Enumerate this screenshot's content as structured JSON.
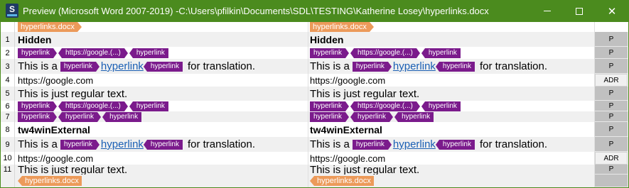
{
  "window": {
    "title": "Preview (Microsoft Word 2007-2019) -C:\\Users\\pfilkin\\Documents\\SDL\\TESTING\\Katherine Losey\\hyperlinks.docx",
    "app_icon_letter": "S",
    "close_glyph": "✕",
    "title_bar_color": "#4b8b1e"
  },
  "file_tag": "hyperlinks.docx",
  "tag_label": "hyperlink",
  "tag_url": "https://google.(...)",
  "rows": [
    {
      "num": "1",
      "src": "Hidden",
      "tgt": "Hidden",
      "status": "P"
    },
    {
      "num": "2",
      "status": "P"
    },
    {
      "num": "3",
      "src_before": "This is a",
      "src_link": "hyperlink",
      "src_after": "for translation.",
      "tgt_before": "This is a",
      "tgt_link": "hyperlink",
      "tgt_after": "for translation.",
      "status": "P"
    },
    {
      "num": "4",
      "src": "https://google.com",
      "tgt": "https://google.com",
      "status": "ADR"
    },
    {
      "num": "5",
      "src": "This is just regular text.",
      "tgt": "This is just regular text.",
      "status": "P"
    },
    {
      "num": "6",
      "status": "P"
    },
    {
      "num": "7",
      "status": "P"
    },
    {
      "num": "8",
      "src": "tw4winExternal",
      "tgt": "tw4winExternal",
      "status": "P"
    },
    {
      "num": "9",
      "src_before": "This is a",
      "src_link": "hyperlink",
      "src_after": "for translation.",
      "tgt_before": "This is a",
      "tgt_link": "hyperlink",
      "tgt_after": "for translation.",
      "status": "P"
    },
    {
      "num": "10",
      "src": "https://google.com",
      "tgt": "https://google.com",
      "status": "ADR"
    },
    {
      "num": "11",
      "src": "This is just regular text.",
      "tgt": "This is just regular text.",
      "status": "P"
    }
  ]
}
